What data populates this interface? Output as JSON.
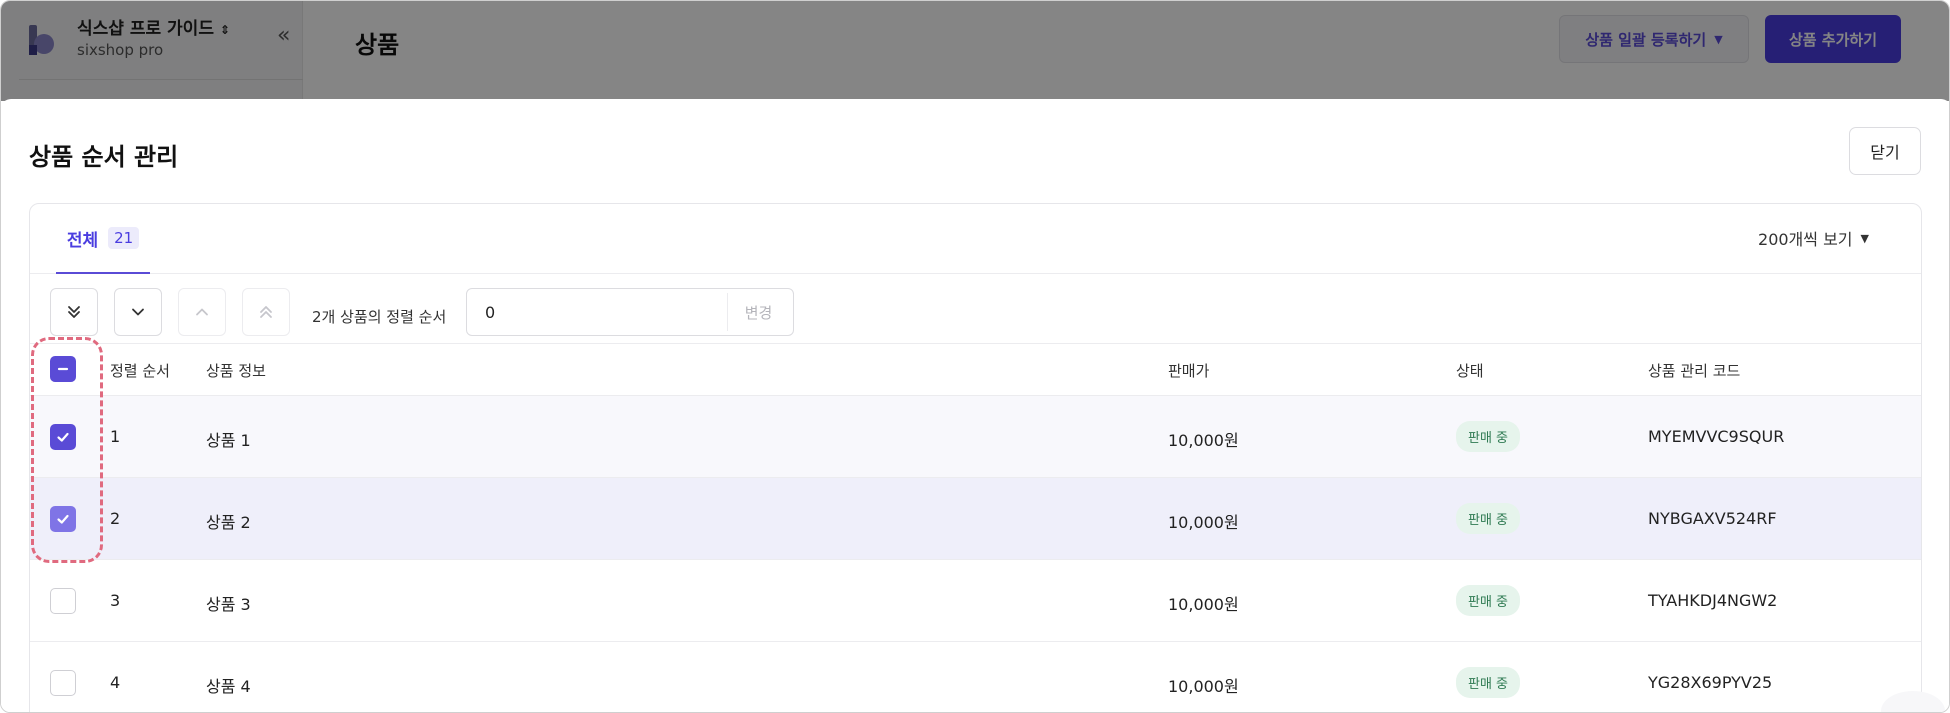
{
  "background": {
    "store_name": "식스샵 프로 가이드",
    "store_plan": "sixshop pro",
    "page_title": "상품",
    "bulk_register_label": "상품 일괄 등록하기",
    "add_product_label": "상품 추가하기"
  },
  "modal": {
    "title": "상품 순서 관리",
    "close_label": "닫기"
  },
  "tabs": {
    "all_label": "전체",
    "all_count": "21",
    "per_page": "200개씩 보기"
  },
  "toolbar": {
    "selection_sort_label": "2개 상품의 정렬 순서",
    "sort_value": "0",
    "apply_label": "변경"
  },
  "table": {
    "headers": {
      "order": "정렬 순서",
      "info": "상품 정보",
      "price": "판매가",
      "status": "상태",
      "code": "상품 관리 코드"
    },
    "rows": [
      {
        "order": "1",
        "name": "상품 1",
        "price": "10,000원",
        "status": "판매 중",
        "code": "MYEMVVC9SQUR"
      },
      {
        "order": "2",
        "name": "상품 2",
        "price": "10,000원",
        "status": "판매 중",
        "code": "NYBGAXV524RF"
      },
      {
        "order": "3",
        "name": "상품 3",
        "price": "10,000원",
        "status": "판매 중",
        "code": "TYAHKDJ4NGW2"
      },
      {
        "order": "4",
        "name": "상품 4",
        "price": "10,000원",
        "status": "판매 중",
        "code": "YG28X69PYV25"
      }
    ]
  },
  "colors": {
    "accent": "#5a4bd6",
    "status_bg": "#e6f4ec",
    "status_text": "#2f7a52",
    "highlight": "#e06a7f"
  }
}
